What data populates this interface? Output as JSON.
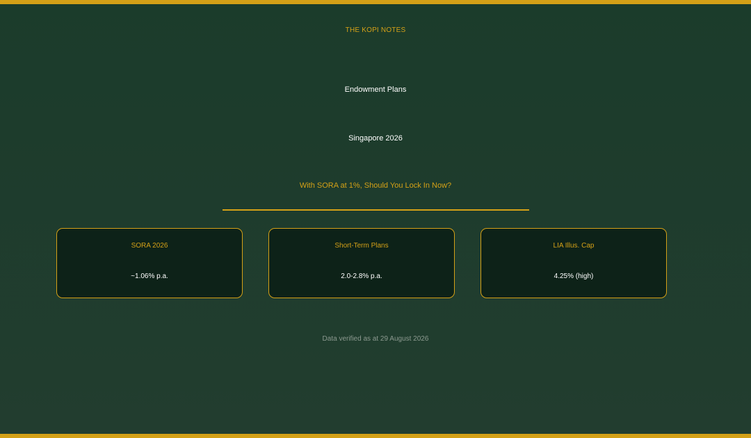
{
  "brand": "THE KOPI NOTES",
  "title": "Endowment Plans",
  "subtitle": "Singapore 2026",
  "question": "With SORA at 1%, Should You Lock In Now?",
  "cards": [
    {
      "label": "SORA 2026",
      "value": "~1.06% p.a."
    },
    {
      "label": "Short-Term Plans",
      "value": "2.0-2.8% p.a."
    },
    {
      "label": "LIA Illus. Cap",
      "value": "4.25% (high)"
    }
  ],
  "footnote": "Data verified as at 29 August 2026",
  "colors": {
    "background": "#1b3c2b",
    "accent": "#d4a017",
    "card_background": "#0d2218",
    "text": "#ffffff",
    "muted_text": "#8c9a90"
  }
}
